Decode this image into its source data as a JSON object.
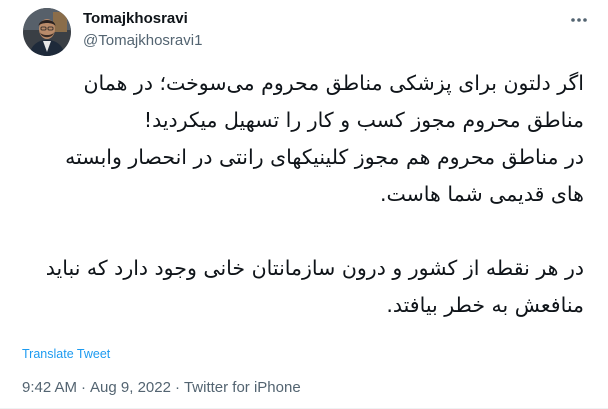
{
  "tweet": {
    "author": {
      "display_name": "Tomajkhosravi",
      "handle": "@Tomajkhosravi1"
    },
    "icons": {
      "avatar": "avatar",
      "more": "more-icon"
    },
    "lines": [
      "اگر دلتون برای پزشکی مناطق محروم می‌سوخت؛ در همان",
      "مناطق محروم مجوز کسب و کار را تسهیل میکردید!",
      "در مناطق محروم هم مجوز کلینیکهای رانتی در انحصار وابسته",
      "های قدیمی شما هاست.",
      "",
      "در هر نقطه از کشور و درون سازمانتان خانی وجود دارد که نباید",
      "منافعش به خطر بیافتد."
    ],
    "translate_label": "Translate Tweet",
    "time": "9:42 AM",
    "date": "Aug 9, 2022",
    "separator": "·",
    "source": "Twitter for iPhone"
  },
  "colors": {
    "text": "#0f1419",
    "secondary": "#536471",
    "link": "#1d9bf0",
    "border": "#eff3f4"
  }
}
